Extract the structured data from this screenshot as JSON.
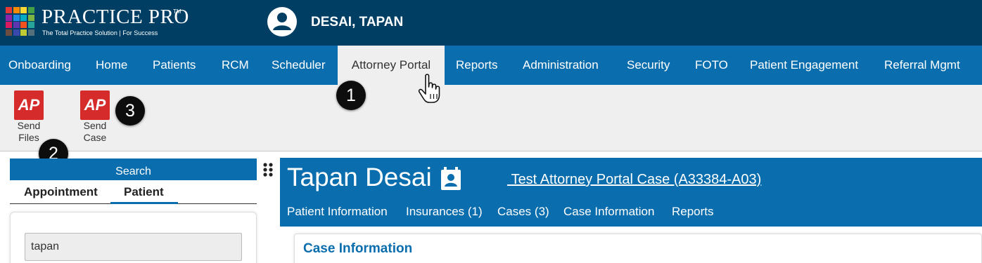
{
  "header": {
    "logo_title": "PRACTICE PRO",
    "logo_tm": "TM",
    "logo_tagline": "The Total Practice Solution | For Success",
    "user_name": "DESAI, TAPAN",
    "logo_colors": [
      "#e53935",
      "#fb8c00",
      "#fdd835",
      "#43a047",
      "#8e24aa",
      "#1e88e5",
      "#00acc1",
      "#7cb342",
      "#d81b60",
      "#5e35b1",
      "#f4511e",
      "#26a69a",
      "#6d4c41",
      "#3949ab",
      "#c0ca33",
      "#546e7a"
    ]
  },
  "nav": {
    "items": [
      {
        "label": "Onboarding"
      },
      {
        "label": "Home"
      },
      {
        "label": "Patients"
      },
      {
        "label": "RCM"
      },
      {
        "label": "Scheduler"
      },
      {
        "label": "Attorney Portal",
        "active": true
      },
      {
        "label": "Reports"
      },
      {
        "label": "Administration"
      },
      {
        "label": "Security"
      },
      {
        "label": "FOTO"
      },
      {
        "label": "Patient Engagement"
      },
      {
        "label": "Referral Mgmt"
      }
    ]
  },
  "toolbar": {
    "send_files": {
      "icon_text": "AP",
      "line1": "Send",
      "line2": "Files"
    },
    "send_case": {
      "icon_text": "AP",
      "line1": "Send",
      "line2": "Case"
    }
  },
  "callouts": [
    "1",
    "2",
    "3"
  ],
  "search": {
    "header": "Search",
    "tabs": [
      "Appointment",
      "Patient"
    ],
    "active_tab": "Patient",
    "input_value": "tapan"
  },
  "patient": {
    "name": "Tapan Desai",
    "case_link": "Test Attorney Portal Case (A33384-A03)",
    "tabs": [
      "Patient Information",
      "Insurances (1)",
      "Cases (3)",
      "Case Information",
      "Reports"
    ]
  },
  "case_info": {
    "title": "Case Information"
  },
  "colors": {
    "header_bg": "#003e63",
    "nav_bg": "#0a6dad",
    "ap_red": "#d52b2b",
    "toolbar_bg": "#efefef"
  }
}
